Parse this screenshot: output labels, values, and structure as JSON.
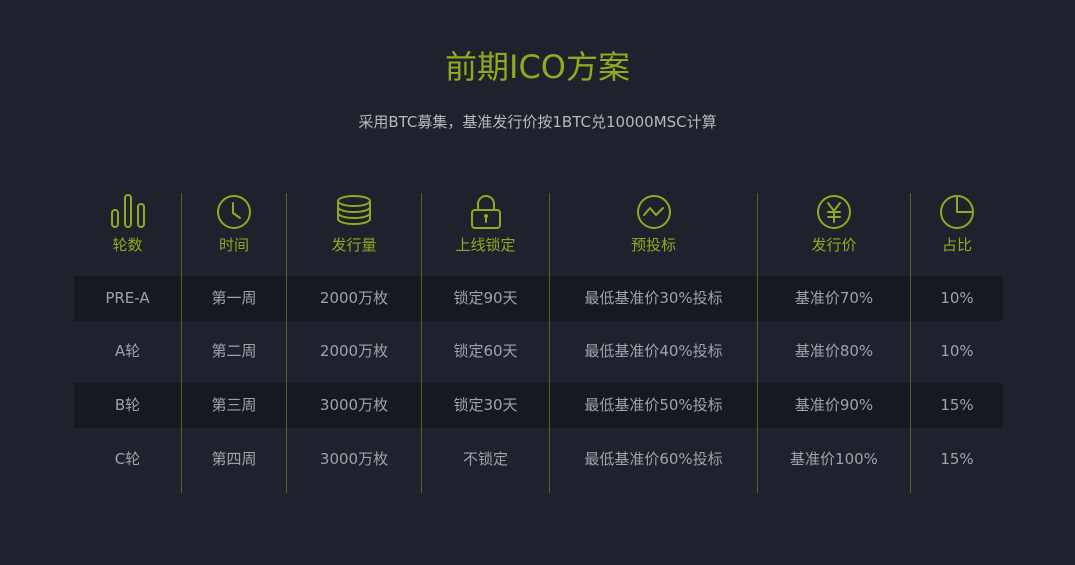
{
  "title": "前期ICO方案",
  "subtitle": "采用BTC募集，基准发行价按1BTC兑10000MSC计算",
  "accent_color": "#8cab20",
  "background_color": "#1f222c",
  "headers": [
    {
      "label": "轮数",
      "icon": "bar-chart-icon"
    },
    {
      "label": "时间",
      "icon": "clock-icon"
    },
    {
      "label": "发行量",
      "icon": "coin-stack-icon"
    },
    {
      "label": "上线锁定",
      "icon": "lock-icon"
    },
    {
      "label": "预投标",
      "icon": "trend-chart-icon"
    },
    {
      "label": "发行价",
      "icon": "yen-icon"
    },
    {
      "label": "占比",
      "icon": "pie-chart-icon"
    }
  ],
  "rows": [
    [
      "PRE-A",
      "第一周",
      "2000万枚",
      "锁定90天",
      "最低基准价30%投标",
      "基准价70%",
      "10%"
    ],
    [
      "A轮",
      "第二周",
      "2000万枚",
      "锁定60天",
      "最低基准价40%投标",
      "基准价80%",
      "10%"
    ],
    [
      "B轮",
      "第三周",
      "3000万枚",
      "锁定30天",
      "最低基准价50%投标",
      "基准价90%",
      "15%"
    ],
    [
      "C轮",
      "第四周",
      "3000万枚",
      "不锁定",
      "最低基准价60%投标",
      "基准价100%",
      "15%"
    ]
  ]
}
